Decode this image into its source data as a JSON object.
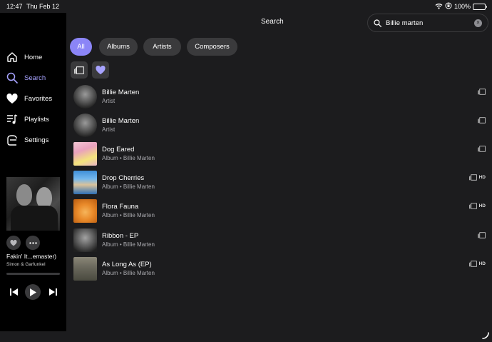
{
  "status": {
    "time": "12:47",
    "date": "Thu Feb 12",
    "battery": "100%"
  },
  "sidebar": {
    "items": [
      {
        "label": "Home",
        "icon": "home-icon"
      },
      {
        "label": "Search",
        "icon": "search-icon",
        "active": true
      },
      {
        "label": "Favorites",
        "icon": "heart-icon"
      },
      {
        "label": "Playlists",
        "icon": "playlist-icon"
      },
      {
        "label": "Settings",
        "icon": "settings-icon"
      }
    ]
  },
  "now_playing": {
    "title": "Fakin' It...emaster)",
    "artist": "Simon & Garfunkel",
    "progress": 0
  },
  "header": {
    "title": "Search"
  },
  "search": {
    "value": "Billie marten"
  },
  "filters": {
    "chips": [
      {
        "label": "All",
        "active": true
      },
      {
        "label": "Albums"
      },
      {
        "label": "Artists"
      },
      {
        "label": "Composers"
      }
    ]
  },
  "results": [
    {
      "title": "Billie Marten",
      "subtitle": "Artist",
      "hd": false,
      "thumb": "t-artist"
    },
    {
      "title": "Billie Marten",
      "subtitle": "Artist",
      "hd": false,
      "thumb": "t-artist"
    },
    {
      "title": "Dog Eared",
      "subtitle": "Album • Billie Marten",
      "hd": false,
      "thumb": "t-dog"
    },
    {
      "title": "Drop Cherries",
      "subtitle": "Album • Billie Marten",
      "hd": true,
      "thumb": "t-drop"
    },
    {
      "title": "Flora Fauna",
      "subtitle": "Album • Billie Marten",
      "hd": true,
      "thumb": "t-flora"
    },
    {
      "title": "Ribbon - EP",
      "subtitle": "Album • Billie Marten",
      "hd": false,
      "thumb": "t-ribbon"
    },
    {
      "title": "As Long As (EP)",
      "subtitle": "Album • Billie Marten",
      "hd": true,
      "thumb": "t-long"
    }
  ],
  "hd_label": "HD",
  "colors": {
    "accent": "#8b85f7",
    "accent_text": "#a7a3ff",
    "battery": "#34c759"
  }
}
